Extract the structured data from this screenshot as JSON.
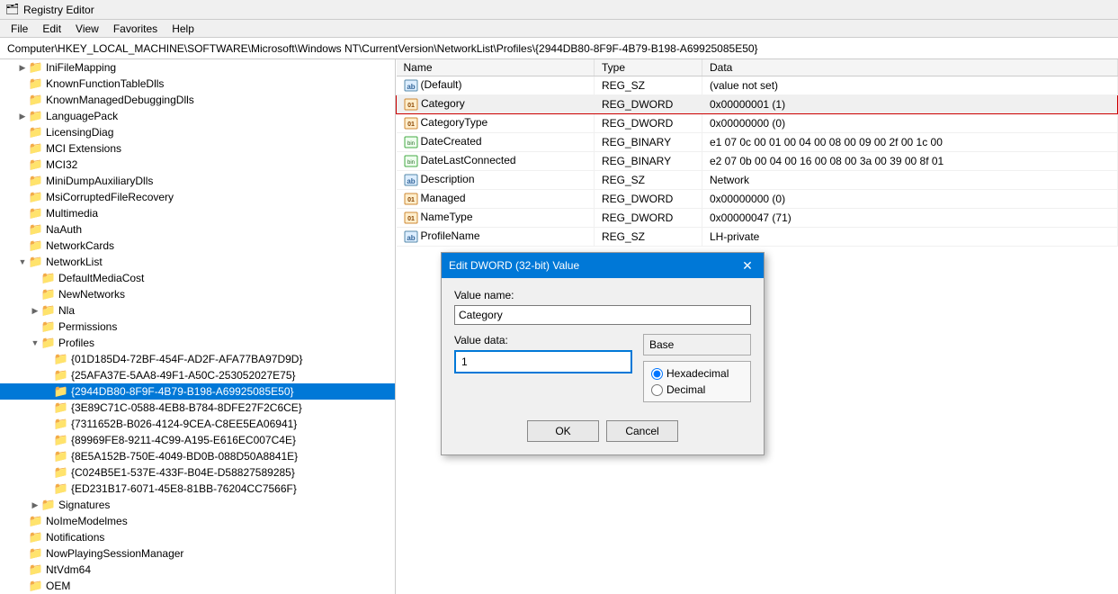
{
  "titleBar": {
    "title": "Registry Editor",
    "icon": "🗂"
  },
  "menuBar": {
    "items": [
      "File",
      "Edit",
      "View",
      "Favorites",
      "Help"
    ]
  },
  "addressBar": {
    "path": "Computer\\HKEY_LOCAL_MACHINE\\SOFTWARE\\Microsoft\\Windows NT\\CurrentVersion\\NetworkList\\Profiles\\{2944DB80-8F9F-4B79-B198-A69925085E50}"
  },
  "treePanel": {
    "items": [
      {
        "label": "IniFileMapping",
        "indent": 1,
        "arrow": "collapsed",
        "selected": false
      },
      {
        "label": "KnownFunctionTableDlls",
        "indent": 1,
        "arrow": "empty",
        "selected": false
      },
      {
        "label": "KnownManagedDebuggingDlls",
        "indent": 1,
        "arrow": "empty",
        "selected": false
      },
      {
        "label": "LanguagePack",
        "indent": 1,
        "arrow": "collapsed",
        "selected": false
      },
      {
        "label": "LicensingDiag",
        "indent": 1,
        "arrow": "empty",
        "selected": false
      },
      {
        "label": "MCI Extensions",
        "indent": 1,
        "arrow": "empty",
        "selected": false
      },
      {
        "label": "MCI32",
        "indent": 1,
        "arrow": "empty",
        "selected": false
      },
      {
        "label": "MiniDumpAuxiliaryDlls",
        "indent": 1,
        "arrow": "empty",
        "selected": false
      },
      {
        "label": "MsiCorruptedFileRecovery",
        "indent": 1,
        "arrow": "empty",
        "selected": false
      },
      {
        "label": "Multimedia",
        "indent": 1,
        "arrow": "empty",
        "selected": false
      },
      {
        "label": "NaAuth",
        "indent": 1,
        "arrow": "empty",
        "selected": false
      },
      {
        "label": "NetworkCards",
        "indent": 1,
        "arrow": "empty",
        "selected": false
      },
      {
        "label": "NetworkList",
        "indent": 1,
        "arrow": "expanded",
        "selected": false
      },
      {
        "label": "DefaultMediaCost",
        "indent": 2,
        "arrow": "empty",
        "selected": false
      },
      {
        "label": "NewNetworks",
        "indent": 2,
        "arrow": "empty",
        "selected": false
      },
      {
        "label": "Nla",
        "indent": 2,
        "arrow": "collapsed",
        "selected": false
      },
      {
        "label": "Permissions",
        "indent": 2,
        "arrow": "empty",
        "selected": false
      },
      {
        "label": "Profiles",
        "indent": 2,
        "arrow": "expanded",
        "selected": false
      },
      {
        "label": "{01D185D4-72BF-454F-AD2F-AFA77BA97D9D}",
        "indent": 3,
        "arrow": "empty",
        "selected": false
      },
      {
        "label": "{25AFA37E-5AA8-49F1-A50C-253052027E75}",
        "indent": 3,
        "arrow": "empty",
        "selected": false
      },
      {
        "label": "{2944DB80-8F9F-4B79-B198-A69925085E50}",
        "indent": 3,
        "arrow": "empty",
        "selected": true
      },
      {
        "label": "{3E89C71C-0588-4EB8-B784-8DFE27F2C6CE}",
        "indent": 3,
        "arrow": "empty",
        "selected": false
      },
      {
        "label": "{7311652B-B026-4124-9CEA-C8EE5EA06941}",
        "indent": 3,
        "arrow": "empty",
        "selected": false
      },
      {
        "label": "{89969FE8-9211-4C99-A195-E616EC007C4E}",
        "indent": 3,
        "arrow": "empty",
        "selected": false
      },
      {
        "label": "{8E5A152B-750E-4049-BD0B-088D50A8841E}",
        "indent": 3,
        "arrow": "empty",
        "selected": false
      },
      {
        "label": "{C024B5E1-537E-433F-B04E-D58827589285}",
        "indent": 3,
        "arrow": "empty",
        "selected": false
      },
      {
        "label": "{ED231B17-6071-45E8-81BB-76204CC7566F}",
        "indent": 3,
        "arrow": "empty",
        "selected": false
      },
      {
        "label": "Signatures",
        "indent": 2,
        "arrow": "collapsed",
        "selected": false
      },
      {
        "label": "NoImeModelmes",
        "indent": 1,
        "arrow": "empty",
        "selected": false
      },
      {
        "label": "Notifications",
        "indent": 1,
        "arrow": "empty",
        "selected": false
      },
      {
        "label": "NowPlayingSessionManager",
        "indent": 1,
        "arrow": "empty",
        "selected": false
      },
      {
        "label": "NtVdm64",
        "indent": 1,
        "arrow": "empty",
        "selected": false
      },
      {
        "label": "OEM",
        "indent": 1,
        "arrow": "empty",
        "selected": false
      }
    ]
  },
  "rightPanel": {
    "columns": [
      "Name",
      "Type",
      "Data"
    ],
    "rows": [
      {
        "name": "(Default)",
        "type": "REG_SZ",
        "data": "(value not set)",
        "icon": "ab",
        "selected": false
      },
      {
        "name": "Category",
        "type": "REG_DWORD",
        "data": "0x00000001 (1)",
        "icon": "dword",
        "selected": false,
        "highlighted": true
      },
      {
        "name": "CategoryType",
        "type": "REG_DWORD",
        "data": "0x00000000 (0)",
        "icon": "dword",
        "selected": false
      },
      {
        "name": "DateCreated",
        "type": "REG_BINARY",
        "data": "e1 07 0c 00 01 00 04 00 08 00 09 00 2f 00 1c 00",
        "icon": "bin",
        "selected": false
      },
      {
        "name": "DateLastConnected",
        "type": "REG_BINARY",
        "data": "e2 07 0b 00 04 00 16 00 08 00 3a 00 39 00 8f 01",
        "icon": "bin",
        "selected": false
      },
      {
        "name": "Description",
        "type": "REG_SZ",
        "data": "Network",
        "icon": "ab",
        "selected": false
      },
      {
        "name": "Managed",
        "type": "REG_DWORD",
        "data": "0x00000000 (0)",
        "icon": "dword",
        "selected": false
      },
      {
        "name": "NameType",
        "type": "REG_DWORD",
        "data": "0x00000047 (71)",
        "icon": "dword",
        "selected": false
      },
      {
        "name": "ProfileName",
        "type": "REG_SZ",
        "data": "LH-private",
        "icon": "ab",
        "selected": false
      }
    ]
  },
  "dialog": {
    "title": "Edit DWORD (32-bit) Value",
    "valueName_label": "Value name:",
    "valueName_value": "Category",
    "valueData_label": "Value data:",
    "valueData_value": "1",
    "base_label": "Base",
    "base_options": [
      {
        "label": "Hexadecimal",
        "checked": true
      },
      {
        "label": "Decimal",
        "checked": false
      }
    ],
    "ok_label": "OK",
    "cancel_label": "Cancel"
  }
}
